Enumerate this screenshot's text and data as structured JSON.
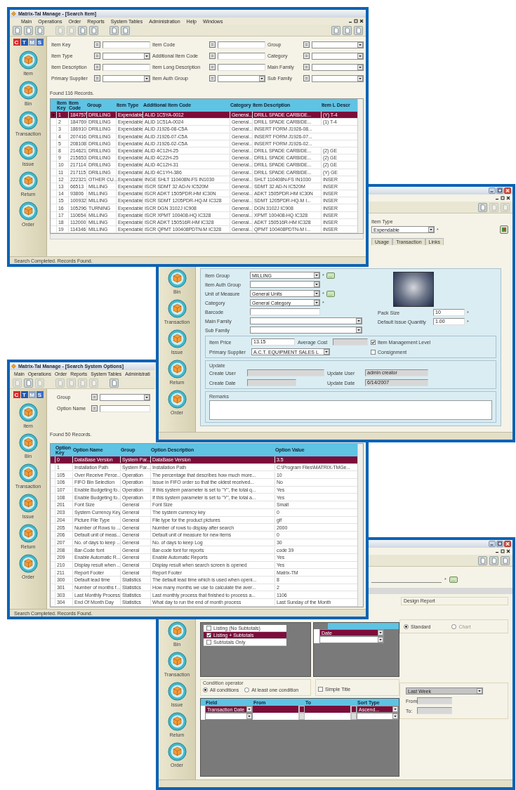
{
  "search_item_window": {
    "title": "Matrix-Tal Manage - [Search Item]",
    "menu": [
      "Main",
      "Operations",
      "Order",
      "Reports",
      "System Tables",
      "Administration",
      "Help",
      "Windows"
    ],
    "logo": [
      "C",
      "T",
      "M",
      "S"
    ],
    "sidebar": [
      "Item",
      "Bin",
      "Transaction",
      "Issue",
      "Return",
      "Order"
    ],
    "filters": [
      {
        "label": "Item Key",
        "operator": "=",
        "kind": "text"
      },
      {
        "label": "Item Code",
        "operator": "=",
        "kind": "text"
      },
      {
        "label": "Group",
        "operator": "=",
        "kind": "dropdown"
      },
      {
        "label": "Item Type",
        "operator": "=",
        "kind": "dropdown"
      },
      {
        "label": "Additional Item Code",
        "operator": "=",
        "kind": "text"
      },
      {
        "label": "Category",
        "operator": "=",
        "kind": "dropdown"
      },
      {
        "label": "Item Description",
        "operator": "=",
        "kind": "text"
      },
      {
        "label": "Item Long Description",
        "operator": "=",
        "kind": "text"
      },
      {
        "label": "Main Family",
        "operator": "=",
        "kind": "dropdown"
      },
      {
        "label": "Primary Supplier",
        "operator": "=",
        "kind": "dropdown"
      },
      {
        "label": "Item Auth Group",
        "operator": "=",
        "kind": "dropdown"
      },
      {
        "label": "Sub Family",
        "operator": "=",
        "kind": "dropdown"
      }
    ],
    "found": "Found 116 Records.",
    "columns": [
      "Item Key",
      "Item Code",
      "Group",
      "Item Type",
      "Additional Item Code",
      "Category",
      "Item Description",
      "Item L Descr"
    ],
    "rows": [
      {
        "selected": true,
        "cells": [
          "1",
          "184757",
          "DRILLING",
          "Expendable",
          "ALID 1C5YA-0012",
          "General...",
          "DRILL SPADE CARBIDE...",
          "(Y) T-4"
        ]
      },
      {
        "selected": false,
        "cells": [
          "2",
          "184769",
          "DRILLING",
          "Expendable",
          "ALID 1C51A-0024",
          "General...",
          "DRILL SPADE CARBIDE...",
          "(1) T-4"
        ]
      },
      {
        "selected": false,
        "cells": [
          "3",
          "186910",
          "DRILLING",
          "Expendable",
          "ALID J1926-08-C5A",
          "General...",
          "INSERT FORM J1926-08..."
        ]
      },
      {
        "selected": false,
        "cells": [
          "4",
          "207416",
          "DRILLING",
          "Expendable",
          "ALID J1926-07-C5A",
          "General...",
          "INSERT FORM J1926-07..."
        ]
      },
      {
        "selected": false,
        "cells": [
          "5",
          "208108",
          "DRILLING",
          "Expendable",
          "ALID J1926-02-C5A",
          "General...",
          "INSERT FORM J1926-02..."
        ]
      },
      {
        "selected": false,
        "cells": [
          "8",
          "214621",
          "DRILLING",
          "Expendable",
          "ALID 4C12H-25",
          "General...",
          "DRILL SPADE CARBIDE...",
          "(2) GE"
        ]
      },
      {
        "selected": false,
        "cells": [
          "9",
          "215653",
          "DRILLING",
          "Expendable",
          "ALID 4C22H-25",
          "General...",
          "DRILL SPADE CARBIDE...",
          "(2) GE"
        ]
      },
      {
        "selected": false,
        "cells": [
          "10",
          "217114",
          "DRILLING",
          "Expendable",
          "ALID 4C12H-31",
          "General...",
          "DRILL SPADE CARBIDE...",
          "(2) GE"
        ]
      },
      {
        "selected": false,
        "cells": [
          "11",
          "217115",
          "DRILLING",
          "Expendable",
          "ALID 4C1YH-386",
          "General...",
          "DRILL SPADE CARBIDE...",
          "(Y) GE"
        ]
      },
      {
        "selected": false,
        "cells": [
          "12",
          "222321",
          "OTHER CU...",
          "Expendable",
          "INGE SHLT 110408N-FS IN1030",
          "General...",
          "SHLT 110408N-FS IN1030",
          "INSER"
        ]
      },
      {
        "selected": false,
        "cells": [
          "13",
          "66513",
          "MILLING",
          "Expendable",
          "ISCR SDMT 32 AD-N IC520M",
          "General...",
          "SDMT 32 AD-N IC520M",
          "INSER"
        ]
      },
      {
        "selected": false,
        "cells": [
          "14",
          "93806",
          "MILLING",
          "Expendable",
          "ISCR ADKT 1505PDR-HM IC30N",
          "General...",
          "ADKT 1505PDR-HM IC30N",
          "INSER"
        ]
      },
      {
        "selected": false,
        "cells": [
          "15",
          "100932",
          "MILLING",
          "Expendable",
          "ISCR SDMT 1205PDR-HQ-M IC328",
          "General...",
          "SDMT 1205PDR-HQ-M I...",
          "INSER"
        ]
      },
      {
        "selected": false,
        "cells": [
          "16",
          "105296",
          "TURNING",
          "Expendable",
          "ISCR DGN 3102J IC908",
          "General...",
          "DGN 3102J IC908",
          "INSER"
        ]
      },
      {
        "selected": false,
        "cells": [
          "17",
          "110654",
          "MILLING",
          "Expendable",
          "ISCR XPMT 100408-HQ IC328",
          "General...",
          "XPMT 100408-HQ IC328",
          "INSER"
        ]
      },
      {
        "selected": false,
        "cells": [
          "18",
          "112000",
          "MILLING",
          "Expendable",
          "ISCR ADKT 150516R-HM IC328",
          "General...",
          "ADKT 150516R-HM IC328",
          "INSER"
        ]
      },
      {
        "selected": false,
        "cells": [
          "19",
          "114346",
          "MILLING",
          "Expendable",
          "ISCR QPMT 100408PDTN-M IC328",
          "General...",
          "QPMT 100408PDTN-M I...",
          "INSER"
        ]
      }
    ],
    "status": "Search Completed. Records Found."
  },
  "item_window": {
    "item_type": {
      "label": "Item Type",
      "value": "Expendable",
      "mark": "*"
    },
    "tabs": [
      {
        "label": "Usage",
        "selected": false
      },
      {
        "label": "Transaction",
        "selected": false
      },
      {
        "label": "Links",
        "selected": false
      }
    ],
    "sidebar": [
      "Bin",
      "Transaction",
      "Issue",
      "Return",
      "Order"
    ],
    "fields": [
      {
        "label": "Item Group",
        "kind": "dropdown",
        "value": "MILLING",
        "mark": "*",
        "lookup": "..."
      },
      {
        "label": "Item Auth Group",
        "kind": "dropdown"
      },
      {
        "label": "Unit of Measure",
        "kind": "dropdown",
        "value": "General Units",
        "mark": "*",
        "lookup": "..."
      },
      {
        "label": "Category",
        "kind": "dropdown",
        "value": "General Category",
        "mark": "*"
      },
      {
        "label": "Barcode",
        "kind": "text"
      },
      {
        "label": "Main Family",
        "kind": "longdropdown"
      },
      {
        "label": "Sub Family",
        "kind": "longdropdown"
      }
    ],
    "quantities": [
      {
        "label": "Pack Size",
        "value": "10",
        "mark": "*"
      },
      {
        "label": "Default Issue Quantity",
        "value": "1.00",
        "mark": "*"
      }
    ],
    "price": {
      "label": "Item Price",
      "value": "13.15"
    },
    "average_cost": {
      "label": "Average Cost"
    },
    "primary_supplier": {
      "label": "Primary Supplier",
      "value": "A.C.T. EQUIPMENT SALES L"
    },
    "options": [
      {
        "label": "Item Management Level",
        "checked": true
      },
      {
        "label": "Consignment",
        "checked": false
      }
    ],
    "update": {
      "title": "Update",
      "fields": [
        {
          "label": "Create User"
        },
        {
          "label": "Update User",
          "value": "admin creator"
        },
        {
          "label": "Create Date"
        },
        {
          "label": "Update Date",
          "value": "6/14/2007"
        }
      ]
    },
    "remarks": {
      "label": "Remarks"
    }
  },
  "search_options_window": {
    "title": "Matrix-Tal Manage - [Search System Options]",
    "menu": [
      "Main",
      "Operations",
      "Order",
      "Reports",
      "System Tables",
      "Administrati"
    ],
    "logo": [
      "C",
      "T",
      "M",
      "S"
    ],
    "sidebar": [
      "Item",
      "Bin",
      "Transaction",
      "Issue",
      "Return",
      "Order"
    ],
    "filters": [
      {
        "label": "Group",
        "operator": "=",
        "kind": "dropdown"
      },
      {
        "label": "Option Name",
        "operator": "=",
        "kind": "text"
      }
    ],
    "found": "Found 50 Records.",
    "columns": [
      "Option Key",
      "Option Name",
      "Group",
      "Option Description",
      "Option Value"
    ],
    "rows": [
      {
        "selected": true,
        "cells": [
          "0",
          "DataBase Version",
          "System Par...",
          "DataBase Version",
          "3.5"
        ]
      },
      {
        "selected": false,
        "cells": [
          "1",
          "Installation Path",
          "System Par...",
          "Installation Path",
          "C:\\Program Files\\MATRIX-TMGe..."
        ]
      },
      {
        "selected": false,
        "cells": [
          "105",
          "Over Receive Perce...",
          "Operation",
          "The percentage that describes how much more...",
          "10"
        ]
      },
      {
        "selected": false,
        "cells": [
          "106",
          "FIFO Bin Selection",
          "Operation",
          "Issue in FIFO order so that the oldest received...",
          "No"
        ]
      },
      {
        "selected": false,
        "cells": [
          "107",
          "Enable Budgeting fo...",
          "Operation",
          "If this system parameter is set to \"Y\", the total q...",
          "Yes"
        ]
      },
      {
        "selected": false,
        "cells": [
          "108",
          "Enable Budgeting fo...",
          "Operation",
          "If this system parameter is set to \"Y\", the total a...",
          "Yes"
        ]
      },
      {
        "selected": false,
        "cells": [
          "201",
          "Font Size",
          "General",
          "Font Size",
          "Small"
        ]
      },
      {
        "selected": false,
        "cells": [
          "203",
          "System Currency Key",
          "General",
          "The system currency key",
          "0"
        ]
      },
      {
        "selected": false,
        "cells": [
          "204",
          "Picture File Type",
          "General",
          "File type for the product pictures",
          "gif"
        ]
      },
      {
        "selected": false,
        "cells": [
          "205",
          "Number of Rows to ...",
          "General",
          "Number of rows to display after search",
          "2000"
        ]
      },
      {
        "selected": false,
        "cells": [
          "206",
          "Default unit of meas...",
          "General",
          "Default unit of measure for new items",
          "0"
        ]
      },
      {
        "selected": false,
        "cells": [
          "207",
          "No. of days to keep ...",
          "General",
          "No. of days to keep Log",
          "30"
        ]
      },
      {
        "selected": false,
        "cells": [
          "208",
          "Bar-Code font",
          "General",
          "Bar-code font for reports",
          "code 39"
        ]
      },
      {
        "selected": false,
        "cells": [
          "209",
          "Enable Automatic R...",
          "General",
          "Enable Automatic Reports",
          "Yes"
        ]
      },
      {
        "selected": false,
        "cells": [
          "210",
          "Display result when ...",
          "General",
          "Display result when search screen is opened",
          "Yes"
        ]
      },
      {
        "selected": false,
        "cells": [
          "211",
          "Report Footer",
          "General",
          "Report Footer",
          "Matrix-TM"
        ]
      },
      {
        "selected": false,
        "cells": [
          "300",
          "Default lead time",
          "Statistics",
          "The default lead time which is used when openi...",
          "8"
        ]
      },
      {
        "selected": false,
        "cells": [
          "301",
          "Number of months f...",
          "Statistics",
          "How many months we use to calculate the aver...",
          "2"
        ]
      },
      {
        "selected": false,
        "cells": [
          "303",
          "Last Monthly Process",
          "Statistics",
          "Last monthly process that finished to process a...",
          "1106"
        ]
      },
      {
        "selected": false,
        "cells": [
          "304",
          "End Of Month Day",
          "Statistics",
          "What day to run the end of month process",
          "Last Sunday of the Month"
        ]
      }
    ],
    "status": "Search Completed. Records Found."
  },
  "report_window": {
    "mark": "*",
    "lookup": "...",
    "design_report": {
      "title": "Design Report",
      "options": [
        {
          "label": "Standard",
          "selected": true
        },
        {
          "label": "Chart",
          "selected": false
        }
      ]
    },
    "sidebar": [
      "Bin",
      "Transaction",
      "Issue",
      "Return",
      "Order"
    ],
    "report_types": [
      {
        "label": "Listing (No Subtotals)",
        "checked": false,
        "selected": false
      },
      {
        "label": "Listing + Subtotals",
        "checked": true,
        "selected": true
      },
      {
        "label": "Subtotals Only",
        "checked": false,
        "selected": false
      }
    ],
    "group_rows": [
      {
        "value": "Date",
        "selected": true
      },
      {
        "selected": false
      }
    ],
    "condition": {
      "title": "Condition operator",
      "options": [
        {
          "label": "All conditions",
          "selected": true
        },
        {
          "label": "At least one condition",
          "selected": false
        }
      ]
    },
    "simple_title": {
      "label": "Simple Title",
      "checked": false
    },
    "grid": {
      "columns": [
        "Field",
        "From",
        "To",
        "Sort Type"
      ],
      "rows": [
        {
          "selected": true,
          "field": "Transaction Date",
          "sort": "Ascend..."
        },
        {
          "selected": false
        }
      ]
    },
    "period": {
      "value": "Last Week",
      "from": "From:",
      "to": "To:"
    }
  }
}
